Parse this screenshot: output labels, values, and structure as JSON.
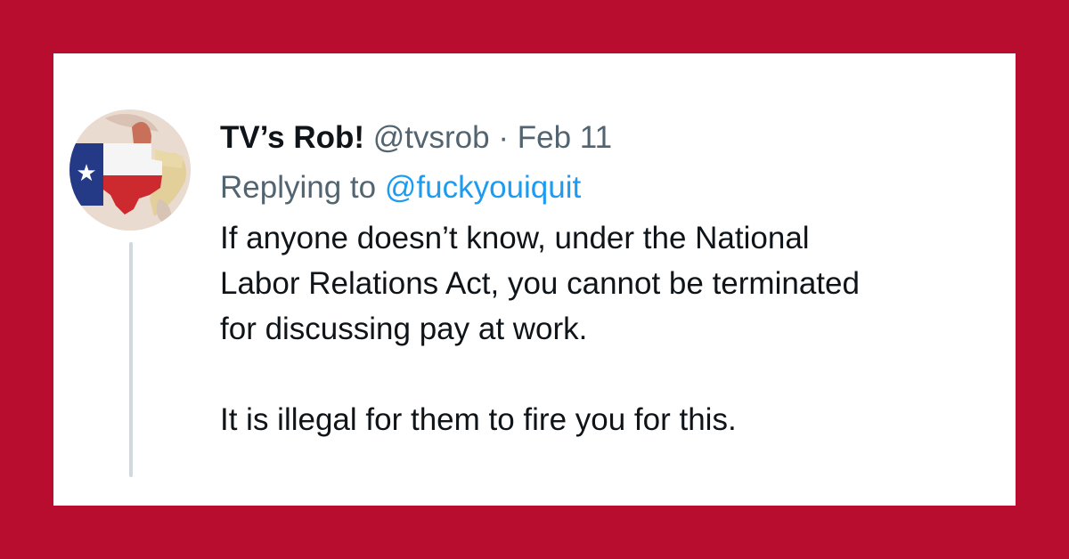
{
  "tweet": {
    "author": {
      "display_name": "TV’s Rob!",
      "handle": "@tvsrob",
      "avatar_icon": "texas-flag-avatar-icon"
    },
    "separator": "·",
    "date": "Feb 11",
    "reply": {
      "prefix": "Replying to",
      "target_handle": "@fuckyouiquit"
    },
    "paragraphs": [
      "If anyone doesn’t know, under the National\nLabor Relations Act, you cannot be terminated\nfor discussing pay at work.",
      "It is illegal for them to fire you for this."
    ]
  },
  "colors": {
    "background": "#b80d2f",
    "card": "#ffffff",
    "text_primary": "#0f1419",
    "text_secondary": "#536471",
    "link": "#1d9bf0",
    "thread_line": "#cfd9de"
  }
}
